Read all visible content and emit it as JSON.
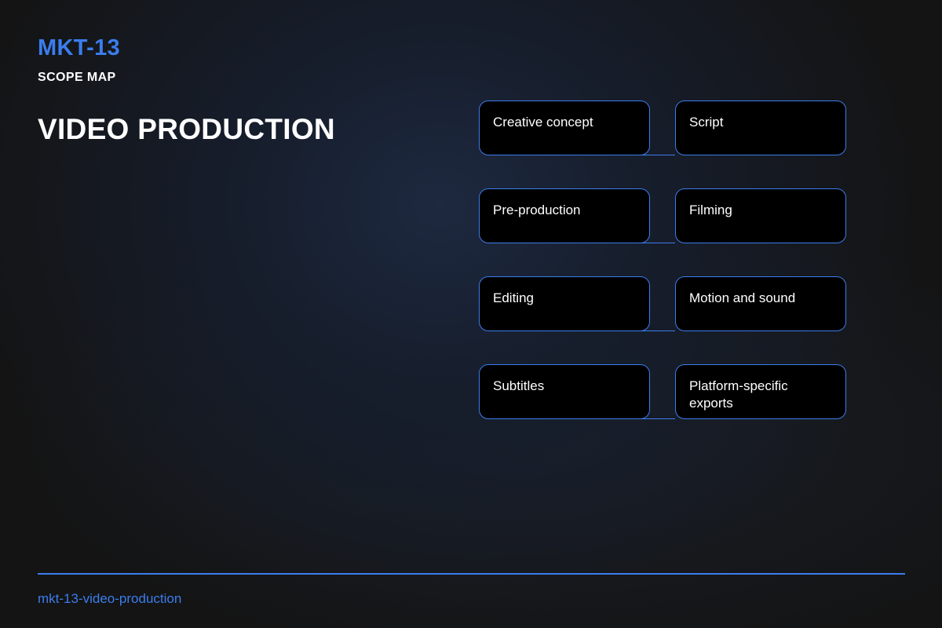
{
  "header": {
    "code": "MKT-13",
    "subtitle": "SCOPE MAP",
    "title": "VIDEO PRODUCTION"
  },
  "nodes": [
    {
      "label": "Creative concept"
    },
    {
      "label": "Script"
    },
    {
      "label": "Pre-production"
    },
    {
      "label": "Filming"
    },
    {
      "label": "Editing"
    },
    {
      "label": "Motion and sound"
    },
    {
      "label": "Subtitles"
    },
    {
      "label": "Platform-specific exports"
    }
  ],
  "footer": {
    "slug": "mkt-13-video-production"
  },
  "colors": {
    "accent": "#3b7ded",
    "node_fill": "#000000",
    "text": "#ffffff"
  }
}
